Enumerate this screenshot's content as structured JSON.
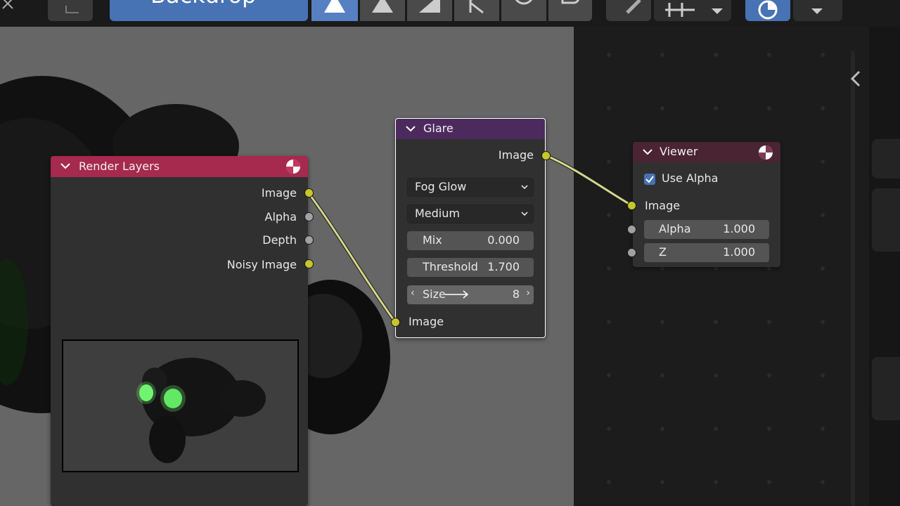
{
  "header": {
    "backdrop_label": "Backdrop"
  },
  "nodes": {
    "render_layers": {
      "title": "Render Layers",
      "outputs": [
        "Image",
        "Alpha",
        "Depth",
        "Noisy Image"
      ]
    },
    "glare": {
      "title": "Glare",
      "output": "Image",
      "glare_type": "Fog Glow",
      "quality": "Medium",
      "mix_label": "Mix",
      "mix_value": "0.000",
      "threshold_label": "Threshold",
      "threshold_value": "1.700",
      "size_label": "Size",
      "size_value": "8",
      "input": "Image"
    },
    "viewer": {
      "title": "Viewer",
      "use_alpha_label": "Use Alpha",
      "use_alpha_checked": true,
      "input_image": "Image",
      "alpha_label": "Alpha",
      "alpha_value": "1.000",
      "z_label": "Z",
      "z_value": "1.000"
    }
  },
  "colors": {
    "render_layers_header": "#a6294e",
    "glare_header": "#4c2a5e",
    "viewer_header": "#4a2433",
    "socket_image": "#c7c729",
    "socket_value": "#a1a1a1",
    "link": "#d6d68a",
    "accent": "#4772b3"
  },
  "icons": [
    "close-icon",
    "image-icon",
    "backdrop-mode-icons",
    "pencil-icon",
    "grid-icon",
    "overlay-icon",
    "chevron-down-icon",
    "chevron-left-icon",
    "render-icon",
    "checkmark-icon"
  ]
}
